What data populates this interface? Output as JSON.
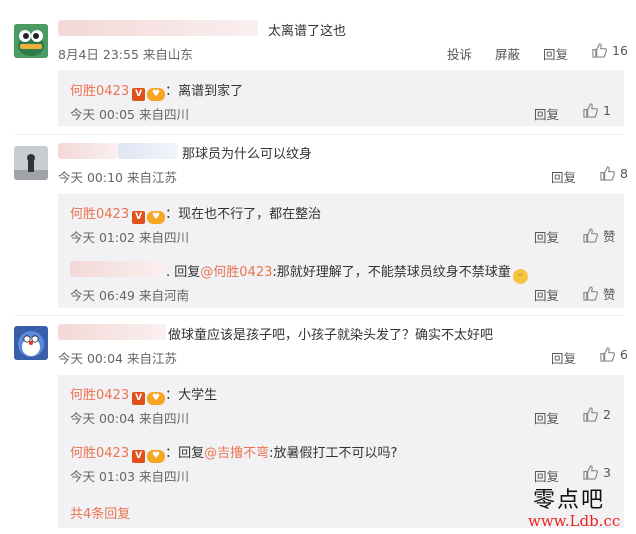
{
  "comments": [
    {
      "text": "太离谱了这也",
      "time": "8月4日 23:55",
      "location": "来自山东",
      "actions": {
        "report": "投诉",
        "block": "屏蔽",
        "reply": "回复",
        "likes": "16"
      },
      "replies": [
        {
          "user": "何胜0423",
          "text": "离谱到家了",
          "time": "今天 00:05",
          "location": "来自四川",
          "reply": "回复",
          "likes": "1"
        }
      ]
    },
    {
      "text": "那球员为什么可以纹身",
      "time": "今天 00:10",
      "location": "来自江苏",
      "actions": {
        "reply": "回复",
        "likes": "8"
      },
      "replies": [
        {
          "user": "何胜0423",
          "text": "现在也不行了，都在整治",
          "time": "今天 01:02",
          "location": "来自四川",
          "reply": "回复",
          "likes": "赞"
        },
        {
          "prefix": "回复",
          "mention": "@何胜0423",
          "text": ":那就好理解了，不能禁球员纹身不禁球童",
          "time": "今天 06:49",
          "location": "来自河南",
          "reply": "回复",
          "likes": "赞"
        }
      ]
    },
    {
      "text": "做球童应该是孩子吧，小孩子就染头发了？确实不太好吧",
      "time": "今天 00:04",
      "location": "来自江苏",
      "actions": {
        "reply": "回复",
        "likes": "6"
      },
      "replies": [
        {
          "user": "何胜0423",
          "text": "大学生",
          "time": "今天 00:04",
          "location": "来自四川",
          "reply": "回复",
          "likes": "2"
        },
        {
          "user": "何胜0423",
          "prefix": "回复",
          "mention": "@吉撸不弯",
          "text": ":放暑假打工不可以吗?",
          "time": "今天 01:03",
          "location": "来自四川",
          "reply": "回复",
          "likes": "3"
        }
      ],
      "more": "共4条回复"
    }
  ],
  "watermark": {
    "line1": "零点吧",
    "line2": "www.Ldb.cc"
  },
  "colors": {
    "username": "#eb7350",
    "reply_bg": "#f2f2f5",
    "text": "#333333",
    "meta": "#666666"
  }
}
